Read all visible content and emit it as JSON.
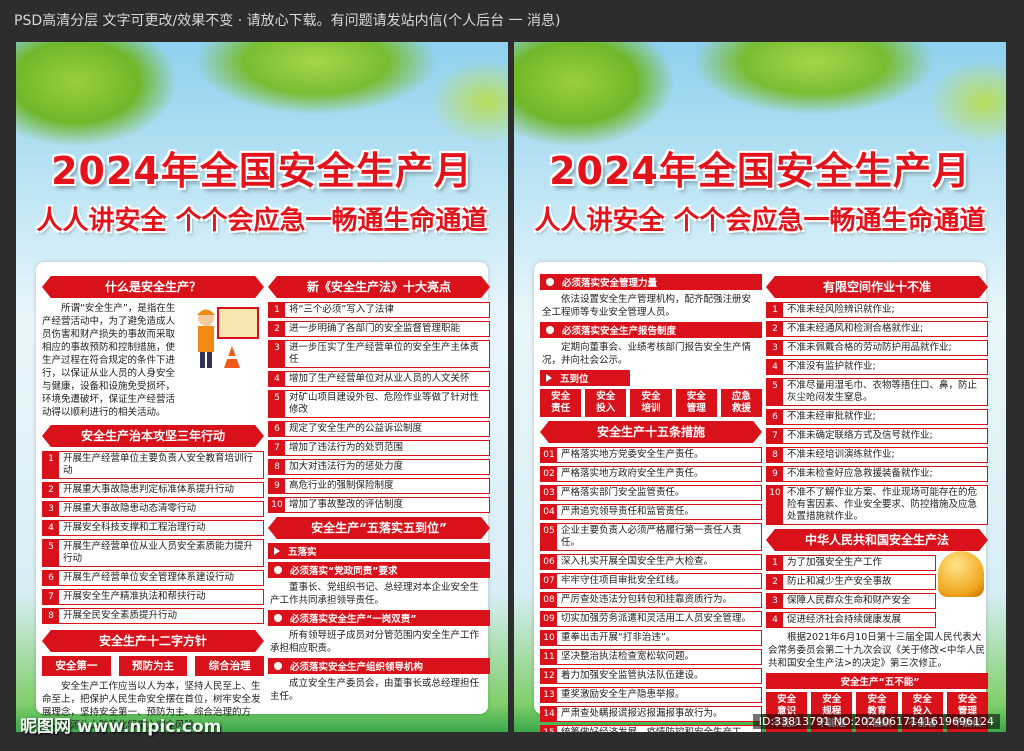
{
  "topbar": "PSD高清分层 文字可更改/效果不变 · 请放心下载。有问题请发站内信(个人后台 一 消息)",
  "title1": "2024年全国安全生产月",
  "title2": "人人讲安全 个个会应急一畅通生命通道",
  "left": {
    "s1_title": "什么是安全生产？",
    "s1_text": "所谓“安全生产”，是指在生产经营活动中，为了避免造成人员伤害和财产损失的事故而采取相应的事故预防和控制措施，使生产过程在符合规定的条件下进行，以保证从业人员的人身安全与健康，设备和设施免受损坏，环境免遭破坏，保证生产经营活动得以顺利进行的相关活动。",
    "s2_title": "安全生产治本攻坚三年行动",
    "s2_items": [
      "开展生产经营单位主要负责人安全教育培训行动",
      "开展重大事故隐患判定标准体系提升行动",
      "开展重大事故隐患动态清零行动",
      "开展安全科技支撑和工程治理行动",
      "开展生产经营单位从业人员安全素质能力提升行动",
      "开展生产经营单位安全管理体系建设行动",
      "开展安全生产精准执法和帮扶行动",
      "开展全民安全素质提升行动"
    ],
    "s3_title": "安全生产十二字方针",
    "s3_btns": [
      "安全第一",
      "预防为主",
      "综合治理"
    ],
    "s3_text": "安全生产工作应当以人为本，坚持人民至上、生命至上，把保护人民生命安全摆在首位，树牢安全发展理念，坚持安全第一、预防为主、综合治理的方针，从源头上防范化解重大安全风险。",
    "s4_title": "新《安全生产法》十大亮点",
    "s4_items": [
      "将“三个必须”写入了法律",
      "进一步明确了各部门的安全监督管理职能",
      "进一步压实了生产经营单位的安全生产主体责任",
      "增加了生产经营单位对从业人员的人文关怀",
      "对矿山项目建设外包、危险作业等做了针对性修改",
      "规定了安全生产的公益诉讼制度",
      "增加了违法行为的处罚范围",
      "加大对违法行为的惩处力度",
      "高危行业的强制保险制度",
      "增加了事故整改的评估制度"
    ],
    "s5_title": "安全生产“五落实五到位”",
    "s5_sub0": "五落实",
    "s5_sub1": "必须落实“党政同责”要求",
    "s5_txt1": "董事长、党组织书记、总经理对本企业安全生产工作共同承担领导责任。",
    "s5_sub2": "必须落实安全生产“一岗双责”",
    "s5_txt2": "所有领导班子成员对分管范围内安全生产工作承担相应职责。",
    "s5_sub3": "必须落实安全生产组织领导机构",
    "s5_txt3": "成立安全生产委员会，由董事长或总经理担任主任。"
  },
  "right": {
    "r1_sub1": "必须落实安全管理力量",
    "r1_txt1": "依法设置安全生产管理机构，配齐配强注册安全工程师等专业安全管理人员。",
    "r1_sub2": "必须落实安全生产报告制度",
    "r1_txt2": "定期向董事会、业绩考核部门报告安全生产情况，并向社会公示。",
    "r1_sub3": "五到位",
    "r1_sq": [
      "安全\n责任",
      "安全\n投入",
      "安全\n培训",
      "安全\n管理",
      "应急\n救援"
    ],
    "r2_title": "安全生产十五条措施",
    "r2_items": [
      "严格落实地方党委安全生产责任。",
      "严格落实地方政府安全生产责任。",
      "严格落实部门安全监管责任。",
      "严肃追究领导责任和监管责任。",
      "企业主要负责人必须严格履行第一责任人责任。",
      "深入扎实开展全国安全生产大检查。",
      "牢牢守住项目审批安全红线。",
      "严厉查处违法分包转包和挂靠资质行为。",
      "切实加强劳务派遣和灵活用工人员安全管理。",
      "重拳出击开展“打非治违”。",
      "坚决整治执法检查宽松软问题。",
      "着力加强安全监管执法队伍建设。",
      "重奖激励安全生产隐患举报。",
      "严肃查处瞒报谎报迟报漏报事故行为。",
      "统筹做好经济发展、疫情防控和安全生产工作。"
    ],
    "r3_title": "有限空间作业十不准",
    "r3_items": [
      "不准未经风险辨识就作业;",
      "不准未经通风和检测合格就作业;",
      "不准未佩戴合格的劳动防护用品就作业;",
      "不准没有监护就作业;",
      "不准尽量用湿毛巾、衣物等捂住口、鼻，防止灰尘呛闷发生窒息。",
      "不准未经审批就作业;",
      "不准未确定联络方式及信号就作业;",
      "不准未经培训演练就作业;",
      "不准未检查好应急救援装备就作业;",
      "不准不了解作业方案、作业现场可能存在的危险有害因素、作业安全要求、防控措施及应急处置措施就作业。"
    ],
    "r4_title": "中华人民共和国安全生产法",
    "r4_items": [
      "为了加强安全生产工作",
      "防止和减少生产安全事故",
      "保障人民群众生命和财产安全",
      "促进经济社会持续健康发展"
    ],
    "r4_text": "根据2021年6月10日第十三届全国人民代表大会常务委员会第二十九次会议《关于修改<中华人民共和国安全生产法>的决定》第三次修正。",
    "r5_sub": "安全生产“五不能”",
    "r5_sq": [
      "安全\n意识\n不能少",
      "安全\n规程\n不能违",
      "安全\n教育\n不能缺",
      "安全\n投入\n不能省",
      "安全\n管理\n不能松"
    ]
  },
  "watermark": "昵图网 www.nipic.com",
  "idtag": "ID:33813791 NO:20240617141619696124"
}
